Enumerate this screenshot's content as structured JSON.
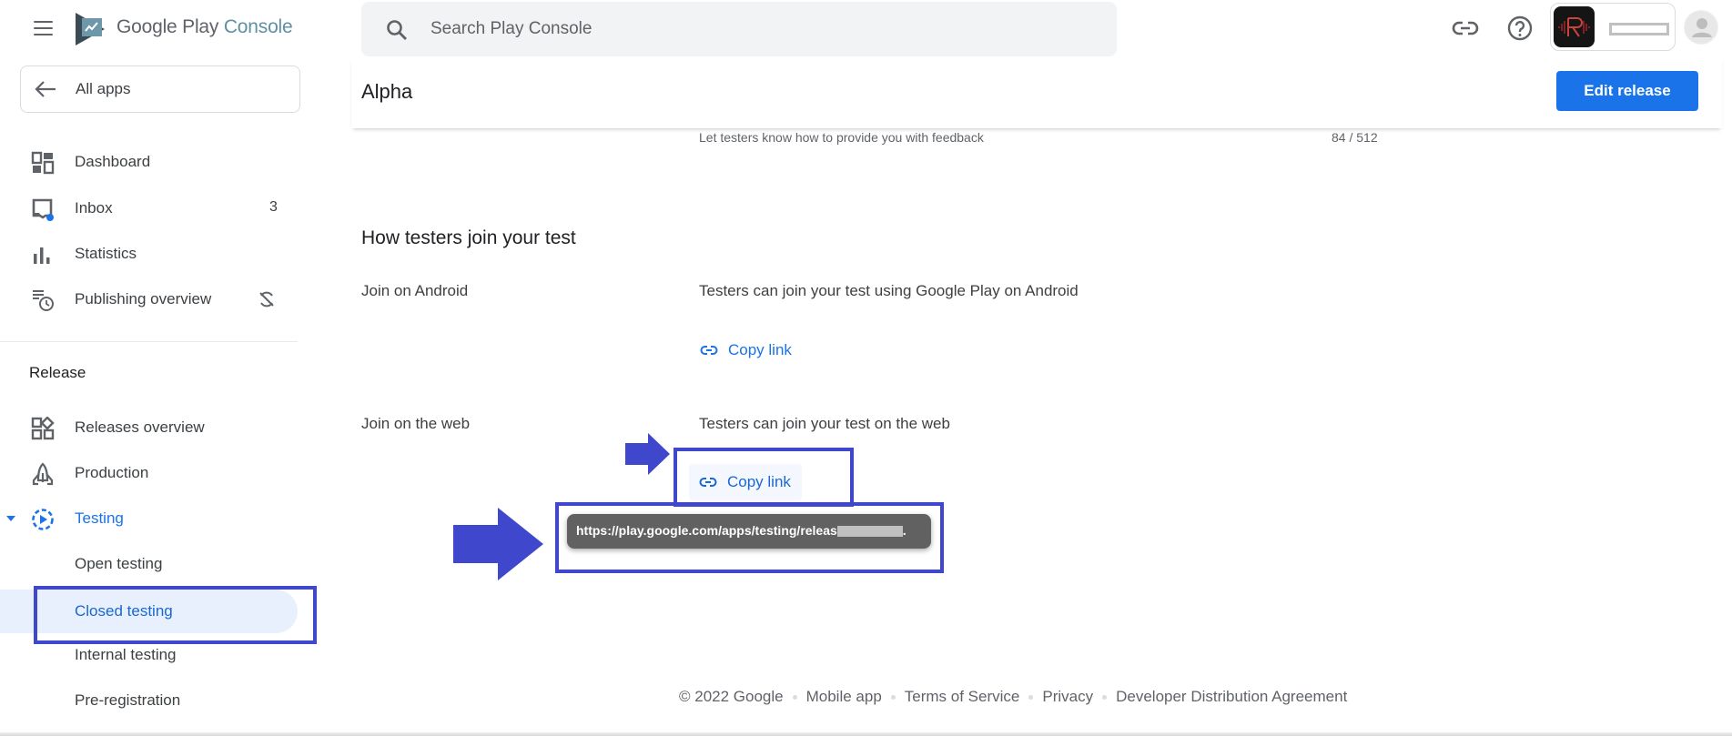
{
  "app": {
    "brand_primary": "Google Play",
    "brand_secondary": "Console"
  },
  "sidebar": {
    "all_apps_label": "All apps",
    "top_items": [
      {
        "label": "Dashboard",
        "icon": "dashboard-icon"
      },
      {
        "label": "Inbox",
        "icon": "inbox-icon",
        "badge": "3"
      },
      {
        "label": "Statistics",
        "icon": "bar-chart-icon"
      },
      {
        "label": "Publishing overview",
        "icon": "publishing-overview-icon",
        "trailing_icon": "sync-disabled-icon"
      }
    ],
    "section_title": "Release",
    "release_items": [
      {
        "label": "Releases overview",
        "icon": "releases-overview-icon"
      },
      {
        "label": "Production",
        "icon": "rocket-icon"
      },
      {
        "label": "Testing",
        "icon": "testing-icon",
        "expanded": true,
        "active": true
      },
      {
        "label": "Open testing"
      },
      {
        "label": "Closed testing",
        "selected": true
      },
      {
        "label": "Internal testing"
      },
      {
        "label": "Pre-registration"
      }
    ]
  },
  "topbar": {
    "search_placeholder": "Search Play Console",
    "search_value": "",
    "icons": [
      "link-icon",
      "help-icon"
    ],
    "account_name": "[redacted]"
  },
  "page": {
    "title": "Alpha",
    "edit_button": "Edit release",
    "feedback_hint": "Let testers know how to provide you with feedback",
    "feedback_counter": "84 / 512",
    "section_heading": "How testers join your test",
    "rows": [
      {
        "label": "Join on Android",
        "description": "Testers can join your test using Google Play on Android",
        "action": "Copy link"
      },
      {
        "label": "Join on the web",
        "description": "Testers can join your test on the web",
        "action": "Copy link"
      }
    ],
    "tooltip_url_visible": "https://play.google.com/apps/testing/releas",
    "tooltip_url_suffix": "."
  },
  "footer": {
    "copyright": "© 2022 Google",
    "links": [
      "Mobile app",
      "Terms of Service",
      "Privacy",
      "Developer Distribution Agreement"
    ]
  },
  "colors": {
    "accent": "#1a73e8",
    "selected_bg": "#e8f0fe",
    "annotation": "#3f48cc",
    "tooltip_bg": "#616161"
  }
}
